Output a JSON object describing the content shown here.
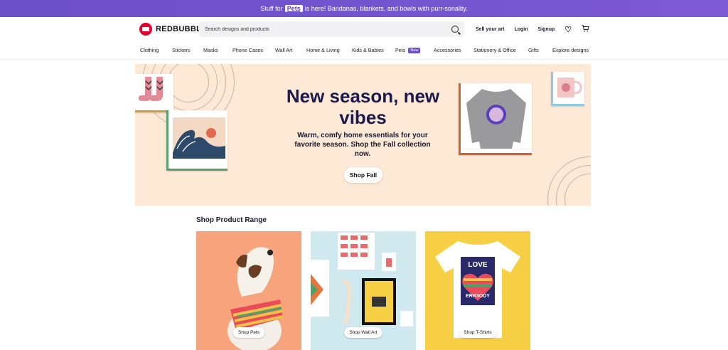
{
  "promo": {
    "prefix": "Stuff for",
    "link": "Pets",
    "suffix": "is here! Bandanas, blankets, and bowls with purr-sonality."
  },
  "header": {
    "logo": "REDBUBBLE",
    "search_placeholder": "Search designs and products",
    "sell": "Sell your art",
    "login": "Login",
    "signup": "Signup"
  },
  "nav": {
    "items": [
      "Clothing",
      "Stickers",
      "Masks",
      "Phone Cases",
      "Wall Art",
      "Home & Living",
      "Kids & Babies",
      "Pets",
      "Accessories",
      "Stationery & Office",
      "Gifts",
      "Explore designs"
    ],
    "badge": "New"
  },
  "hero": {
    "title_line1": "New season, new",
    "title_line2": "vibes",
    "subtitle": "Warm, comfy home essentials for your favorite season. Shop the Fall collection now.",
    "button": "Shop Fall"
  },
  "range": {
    "title": "Shop Product Range",
    "tiles": [
      {
        "label": "Shop Pets",
        "bg": "#f7a37b"
      },
      {
        "label": "Shop Wall Art",
        "bg": "#cfe9ee"
      },
      {
        "label": "Shop T-Shirts",
        "bg": "#f7cf45"
      }
    ],
    "tshirt_text1": "LOVE",
    "tshirt_text2": "ERR3ODY"
  },
  "colors": {
    "promo": "#6b4fc8",
    "brand": "#e4002b",
    "hero_bg": "#fde9d6",
    "title": "#1a1a4e"
  }
}
